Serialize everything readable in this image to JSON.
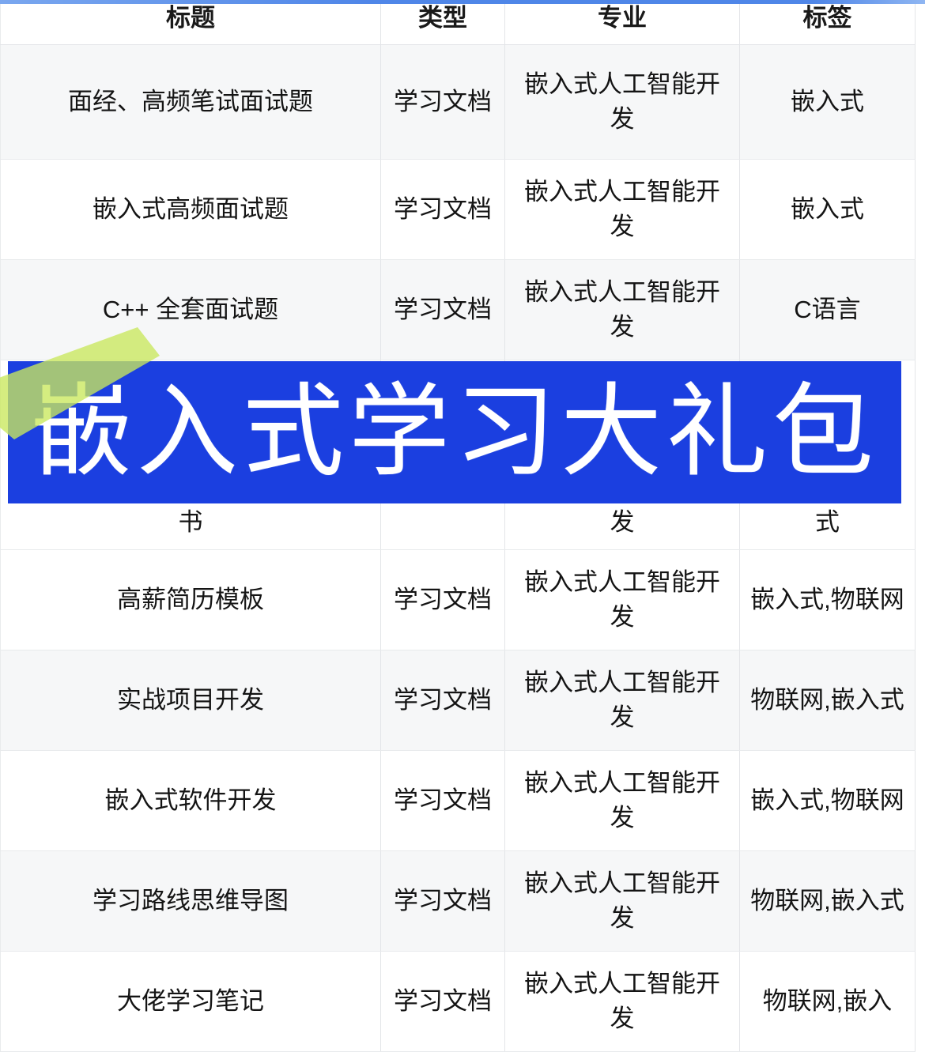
{
  "table": {
    "columns": [
      "标题",
      "类型",
      "专业",
      "标签"
    ],
    "rows": [
      {
        "title": "面经、高频笔试面试题",
        "type": "学习文档",
        "major": "嵌入式人工智能开发",
        "tags": "嵌入式"
      },
      {
        "title": "嵌入式高频面试题",
        "type": "学习文档",
        "major": "嵌入式人工智能开发",
        "tags": "嵌入式"
      },
      {
        "title": "C++ 全套面试题",
        "type": "学习文档",
        "major": "嵌入式人工智能开发",
        "tags": "C语言"
      },
      {
        "title": "书",
        "type": "",
        "major": "发",
        "tags": "式"
      },
      {
        "title": "高薪简历模板",
        "type": "学习文档",
        "major": "嵌入式人工智能开发",
        "tags": "嵌入式,物联网"
      },
      {
        "title": "实战项目开发",
        "type": "学习文档",
        "major": "嵌入式人工智能开发",
        "tags": "物联网,嵌入式"
      },
      {
        "title": "嵌入式软件开发",
        "type": "学习文档",
        "major": "嵌入式人工智能开发",
        "tags": "嵌入式,物联网"
      },
      {
        "title": "学习路线思维导图",
        "type": "学习文档",
        "major": "嵌入式人工智能开发",
        "tags": "物联网,嵌入式"
      },
      {
        "title": "大佬学习笔记",
        "type": "学习文档",
        "major": "嵌入式人工智能开发",
        "tags": "物联网,嵌入"
      }
    ]
  },
  "promo": {
    "banner_text": "嵌入式学习大礼包",
    "banner_color": "#1b3fe0",
    "banner_text_color": "#ffffff",
    "highlighter_color": "#c9e85c"
  },
  "accent": {
    "top_bar_color": "#4f86e8"
  }
}
